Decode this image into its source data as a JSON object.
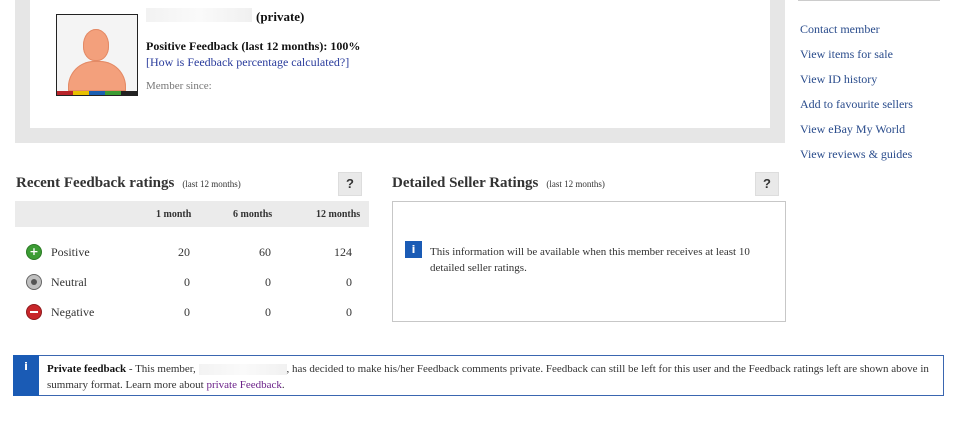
{
  "profile": {
    "private_tag": "(private)",
    "positive_feedback": "Positive Feedback (last 12 months): 100%",
    "how_link": "[How is Feedback percentage calculated?]",
    "member_since": "Member since:"
  },
  "side_links": [
    "Contact member",
    "View items for sale",
    "View ID history",
    "Add to favourite sellers",
    "View eBay My World",
    "View reviews & guides"
  ],
  "recent_feedback": {
    "title": "Recent Feedback ratings",
    "subtitle": "(last 12 months)",
    "help": "?",
    "columns": [
      "1 month",
      "6 months",
      "12 months"
    ],
    "rows": [
      {
        "label": "Positive",
        "values": [
          "20",
          "60",
          "124"
        ],
        "icon": "positive-plus-icon"
      },
      {
        "label": "Neutral",
        "values": [
          "0",
          "0",
          "0"
        ],
        "icon": "neutral-dot-icon"
      },
      {
        "label": "Negative",
        "values": [
          "0",
          "0",
          "0"
        ],
        "icon": "negative-minus-icon"
      }
    ]
  },
  "detailed_seller": {
    "title": "Detailed Seller Ratings",
    "subtitle": "(last 12 months)",
    "help": "?",
    "info": "This information will be available when this member receives at least 10 detailed seller ratings."
  },
  "private_notice": {
    "bold": "Private feedback",
    "text_a": " - This member, ",
    "text_b": ", has decided to make his/her Feedback comments private. Feedback can still be left for this user and the Feedback ratings left are shown above in summary format. Learn more about ",
    "link": "private Feedback",
    "text_c": "."
  },
  "colors": {
    "link": "#2a3c9c",
    "info_blue": "#1a5bb5",
    "positive": "#3c9c34",
    "negative": "#c8262a",
    "visited_link": "#6b2189"
  }
}
